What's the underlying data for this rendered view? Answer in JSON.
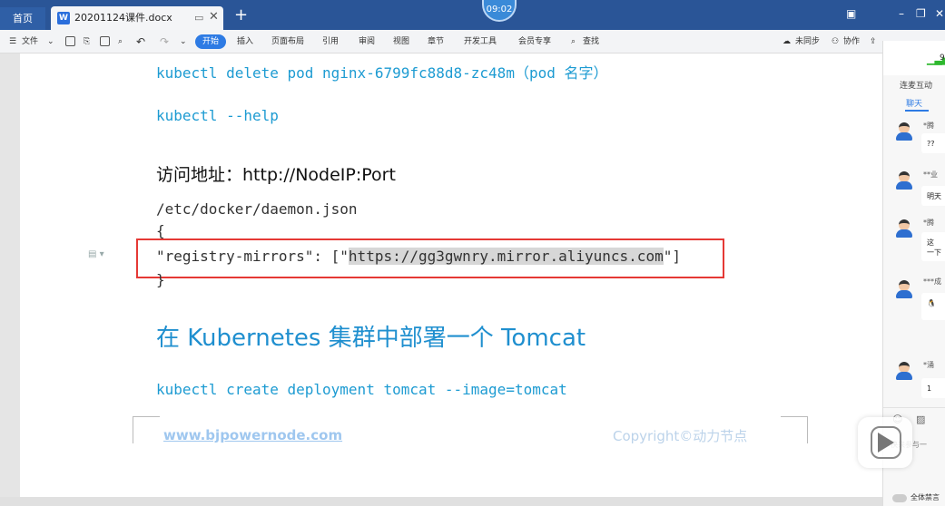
{
  "tabs": {
    "home": "首页",
    "doc_name": "20201124课件.docx",
    "clock": "09:02"
  },
  "ribbon": {
    "file": "文件",
    "start": "开始",
    "insert": "插入",
    "layout": "页面布局",
    "reference": "引用",
    "review": "审阅",
    "view": "视图",
    "section": "章节",
    "dev": "开发工具",
    "member": "会员专享",
    "search": "查找",
    "sync": "未同步",
    "collab": "协作",
    "share": "分享"
  },
  "doc": {
    "line1": "kubectl delete pod nginx-6799fc88d8-zc48m（pod 名字）",
    "line2": "kubectl --help",
    "access_heading": "访问地址：http://NodeIP:Port",
    "daemon_path": "/etc/docker/daemon.json",
    "brace_open": "{",
    "mirror_key": "\"registry-mirrors\": [\"",
    "mirror_url": "https://gg3gwnry.mirror.aliyuncs.com",
    "mirror_end": "\"]",
    "brace_close": "}",
    "section_heading": "在 Kubernetes 集群中部署一个 Tomcat",
    "create_cmd": "kubectl create deployment tomcat --image=tomcat",
    "footer_url": "www.bjpowernode.com",
    "footer_copy": "Copyright©动力节点"
  },
  "panel": {
    "signal_num": "9",
    "live_label": "连麦互动",
    "chat_tab": "聊天",
    "messages": [
      {
        "name": "*腾",
        "text": "??"
      },
      {
        "name": "**业",
        "text": "明天"
      },
      {
        "name": "*腾",
        "text": "这\n一下"
      },
      {
        "name": "***成",
        "text": ""
      },
      {
        "name": "*涌",
        "text": "1"
      }
    ],
    "input_placeholder": "快来参与一",
    "mute_label": "全体禁言"
  }
}
